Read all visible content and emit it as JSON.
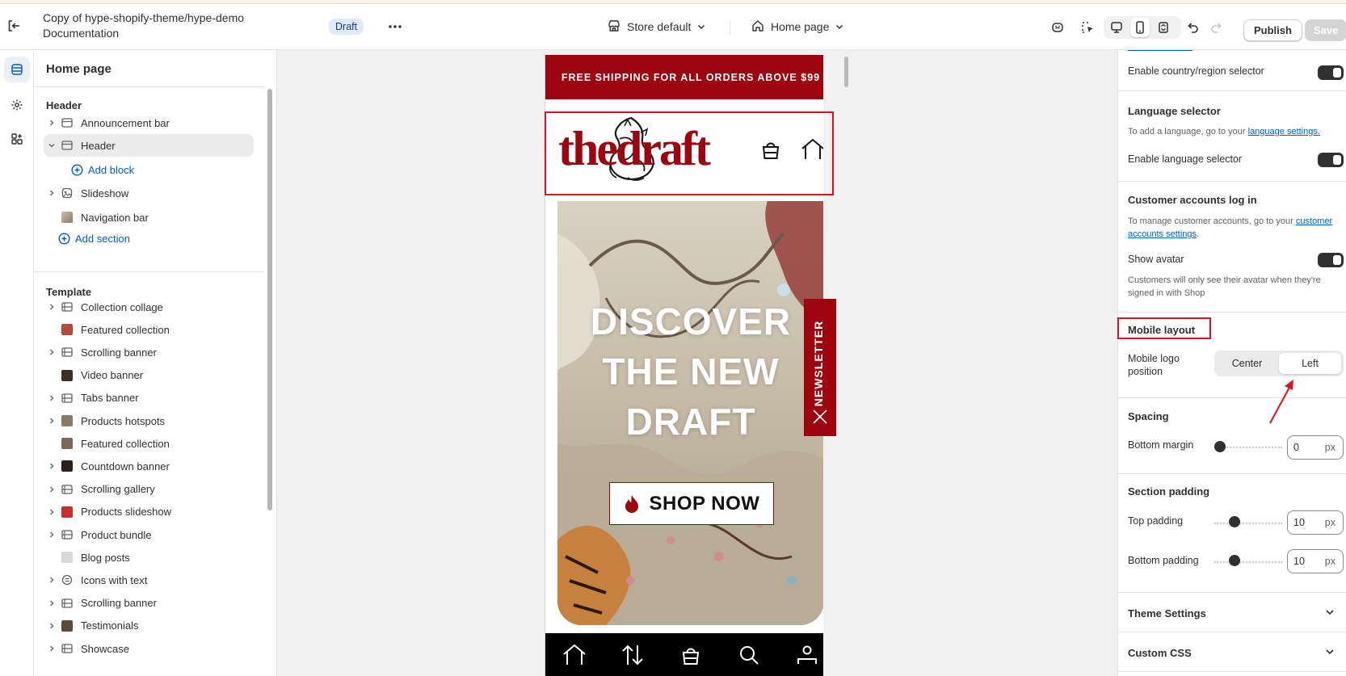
{
  "topbar": {
    "title": "Copy of hype-shopify-theme/hype-demo Documentation",
    "status_badge": "Draft",
    "store_select": "Store default",
    "page_select": "Home page",
    "publish_label": "Publish",
    "save_label": "Save"
  },
  "left_panel": {
    "title": "Home page",
    "header_group": "Header",
    "header_items": [
      {
        "label": "Announcement bar"
      },
      {
        "label": "Header"
      },
      {
        "label": "Slideshow"
      },
      {
        "label": "Navigation bar"
      }
    ],
    "add_block": "Add block",
    "add_section": "Add section",
    "template_group": "Template",
    "template_items": [
      {
        "label": "Collection collage"
      },
      {
        "label": "Featured collection"
      },
      {
        "label": "Scrolling banner"
      },
      {
        "label": "Video banner"
      },
      {
        "label": "Tabs banner"
      },
      {
        "label": "Products hotspots"
      },
      {
        "label": "Featured collection"
      },
      {
        "label": "Countdown banner"
      },
      {
        "label": "Scrolling gallery"
      },
      {
        "label": "Products slideshow"
      },
      {
        "label": "Product bundle"
      },
      {
        "label": "Blog posts"
      },
      {
        "label": "Icons with text"
      },
      {
        "label": "Scrolling banner"
      },
      {
        "label": "Testimonials"
      },
      {
        "label": "Showcase"
      }
    ]
  },
  "preview": {
    "announcement": "FREE SHIPPING FOR ALL ORDERS ABOVE $99",
    "logo_text": "thedraft",
    "hero_heading_lines": [
      "DISCOVER",
      "THE NEW",
      "DRAFT"
    ],
    "shop_button": "SHOP NOW",
    "newsletter_tab": "NEWSLETTER",
    "brand_color": "#9c0510"
  },
  "right_panel": {
    "country_selector_label": "Enable country/region selector",
    "language_heading": "Language selector",
    "language_help_prefix": "To add a language, go to your ",
    "language_help_link": "language settings.",
    "language_toggle_label": "Enable language selector",
    "accounts_heading": "Customer accounts log in",
    "accounts_help_prefix": "To manage customer accounts, go to your ",
    "accounts_help_link": "customer accounts settings",
    "accounts_help_suffix": ".",
    "avatar_label": "Show avatar",
    "avatar_help": "Customers will only see their avatar when they're signed in with Shop",
    "mobile_layout_heading": "Mobile layout",
    "logo_position_label": "Mobile logo position",
    "logo_position_options": [
      "Center",
      "Left"
    ],
    "logo_position_selected": "Left",
    "spacing_heading": "Spacing",
    "bottom_margin_label": "Bottom margin",
    "bottom_margin_value": "0",
    "unit": "px",
    "section_padding_heading": "Section padding",
    "top_padding_label": "Top padding",
    "top_padding_value": "10",
    "bottom_padding_label": "Bottom padding",
    "bottom_padding_value": "10",
    "theme_settings": "Theme Settings",
    "custom_css": "Custom CSS"
  }
}
